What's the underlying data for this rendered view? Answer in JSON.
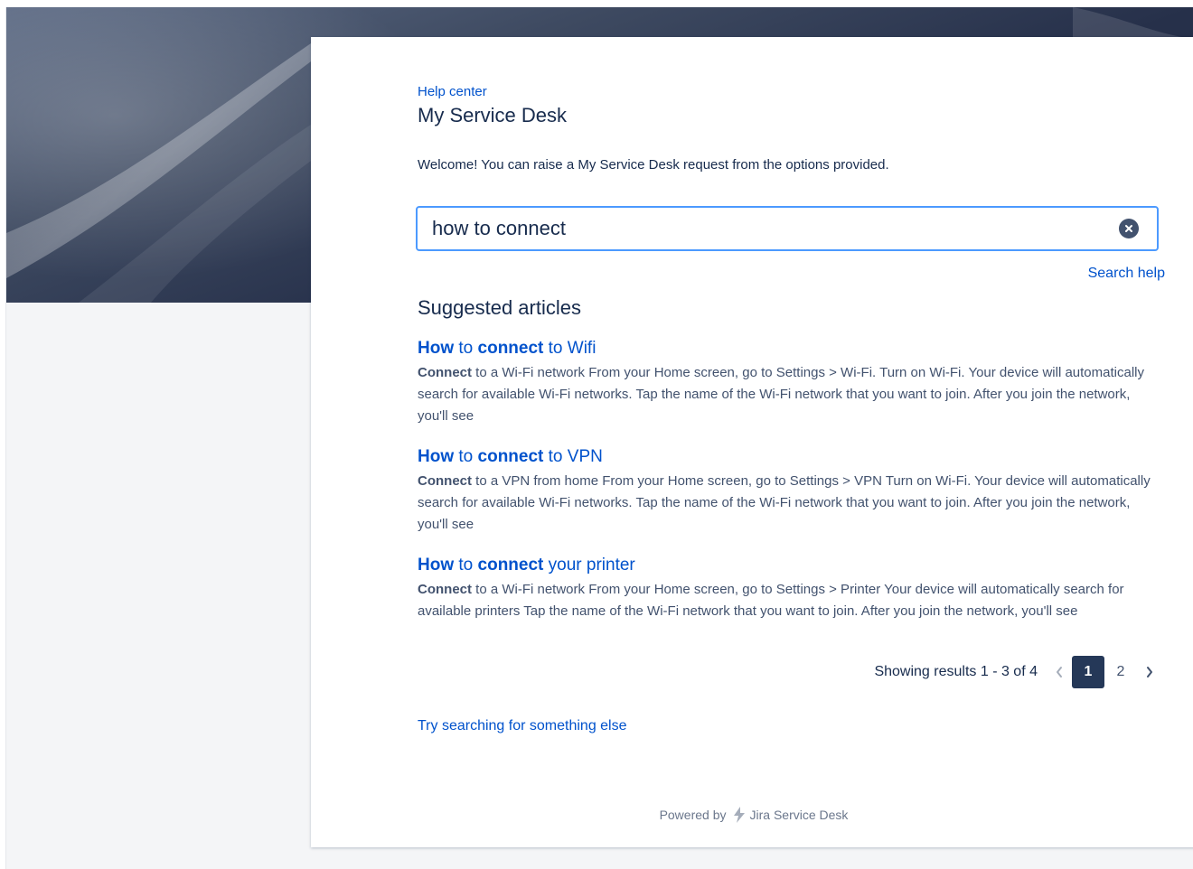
{
  "header": {
    "breadcrumb": "Help center",
    "title": "My Service Desk",
    "welcome": "Welcome! You can raise a My Service Desk request from the options provided."
  },
  "search": {
    "value": "how to connect",
    "placeholder": "",
    "help_link": "Search help"
  },
  "suggested": {
    "heading": "Suggested articles",
    "articles": [
      {
        "title_bold_1": "How",
        "title_mid": " to ",
        "title_bold_2": "connect",
        "title_rest": " to Wifi",
        "excerpt_bold": "Connect",
        "excerpt_rest": " to a Wi-Fi network From your Home screen, go to Settings > Wi-Fi. Turn on Wi-Fi. Your device will automatically search for available Wi-Fi networks. Tap the name of the Wi-Fi network that you want to join. After you join the network, you'll see"
      },
      {
        "title_bold_1": "How",
        "title_mid": " to ",
        "title_bold_2": "connect",
        "title_rest": " to VPN",
        "excerpt_bold": "Connect",
        "excerpt_rest": " to a VPN from home From your Home screen, go to Settings > VPN Turn on Wi-Fi. Your device will automatically search for available Wi-Fi networks. Tap the name of the Wi-Fi network that you want to join. After you join the network, you'll see"
      },
      {
        "title_bold_1": "How",
        "title_mid": " to ",
        "title_bold_2": "connect",
        "title_rest": " your printer",
        "excerpt_bold": "Connect",
        "excerpt_rest": " to a Wi-Fi network From your Home screen, go to Settings > Printer  Your device will automatically search for available printers Tap the name of the Wi-Fi network that you want to join. After you join the network, you'll see"
      }
    ]
  },
  "pagination": {
    "results_text": "Showing results 1 - 3 of 4",
    "pages": [
      "1",
      "2"
    ],
    "current_page": "1"
  },
  "try_else": "Try searching for something else",
  "footer": {
    "powered_by": "Powered by",
    "product": "Jira Service Desk"
  },
  "colors": {
    "link": "#0052cc",
    "text": "#172b4d",
    "focus_border": "#4c9aff",
    "current_page_bg": "#253858"
  }
}
